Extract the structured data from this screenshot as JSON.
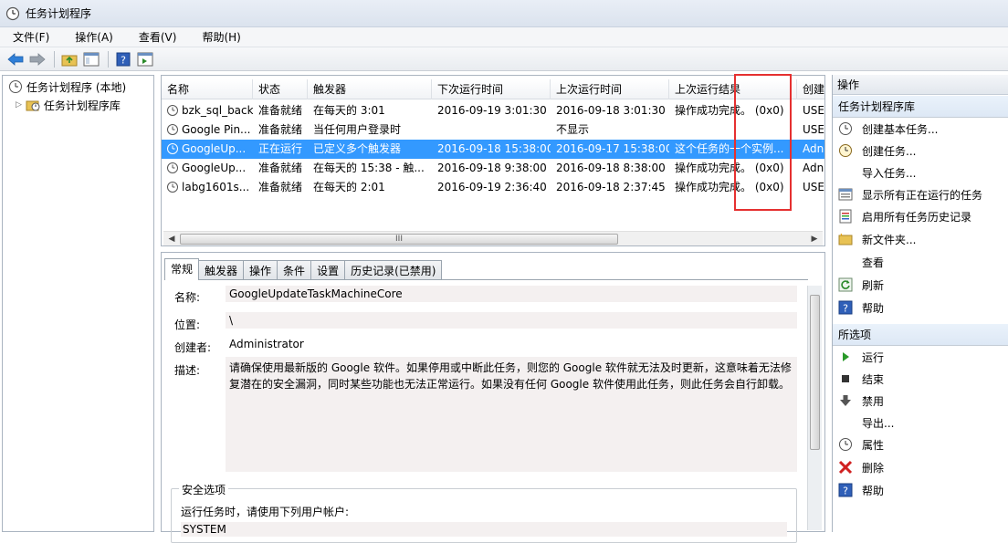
{
  "window": {
    "title": "任务计划程序"
  },
  "menu": [
    "文件(F)",
    "操作(A)",
    "查看(V)",
    "帮助(H)"
  ],
  "tree": {
    "root": "任务计划程序 (本地)",
    "child": "任务计划程序库"
  },
  "list": {
    "columns": [
      "名称",
      "状态",
      "触发器",
      "下次运行时间",
      "上次运行时间",
      "上次运行结果",
      "创建"
    ],
    "rows": [
      [
        "bzk_sql_back",
        "准备就绪",
        "在每天的 3:01",
        "2016-09-19 3:01:30",
        "2016-09-18 3:01:30",
        "操作成功完成。 (0x0)",
        "USE"
      ],
      [
        "Google Pin...",
        "准备就绪",
        "当任何用户登录时",
        "",
        "不显示",
        "",
        "USE"
      ],
      [
        "GoogleUp...",
        "正在运行",
        "已定义多个触发器",
        "2016-09-18 15:38:00",
        "2016-09-17 15:38:00",
        "这个任务的一个实例...",
        "Adn"
      ],
      [
        "GoogleUp...",
        "准备就绪",
        "在每天的 15:38 - 触...",
        "2016-09-18 9:38:00",
        "2016-09-18 8:38:00",
        "操作成功完成。 (0x0)",
        "Adn"
      ],
      [
        "labg1601s...",
        "准备就绪",
        "在每天的 2:01",
        "2016-09-19 2:36:40",
        "2016-09-18 2:37:45",
        "操作成功完成。 (0x0)",
        "USE"
      ]
    ],
    "scroll_grip": "III"
  },
  "details": {
    "tabs": [
      "常规",
      "触发器",
      "操作",
      "条件",
      "设置",
      "历史记录(已禁用)"
    ],
    "name_label": "名称:",
    "name_value": "GoogleUpdateTaskMachineCore",
    "location_label": "位置:",
    "location_value": "\\",
    "author_label": "创建者:",
    "author_value": "Administrator",
    "desc_label": "描述:",
    "desc_value": "请确保使用最新版的 Google 软件。如果停用或中断此任务，则您的 Google 软件就无法及时更新，这意味着无法修复潜在的安全漏洞，同时某些功能也无法正常运行。如果没有任何 Google 软件使用此任务，则此任务会自行卸载。",
    "security_title": "安全选项",
    "security_text": "运行任务时，请使用下列用户帐户:",
    "security_user": "SYSTEM"
  },
  "actions": {
    "header": "操作",
    "section1": "任务计划程序库",
    "items1": [
      "创建基本任务...",
      "创建任务...",
      "导入任务...",
      "显示所有正在运行的任务",
      "启用所有任务历史记录",
      "新文件夹...",
      "查看",
      "刷新",
      "帮助"
    ],
    "section2": "所选项",
    "items2": [
      "运行",
      "结束",
      "禁用",
      "导出...",
      "属性",
      "删除",
      "帮助"
    ]
  }
}
